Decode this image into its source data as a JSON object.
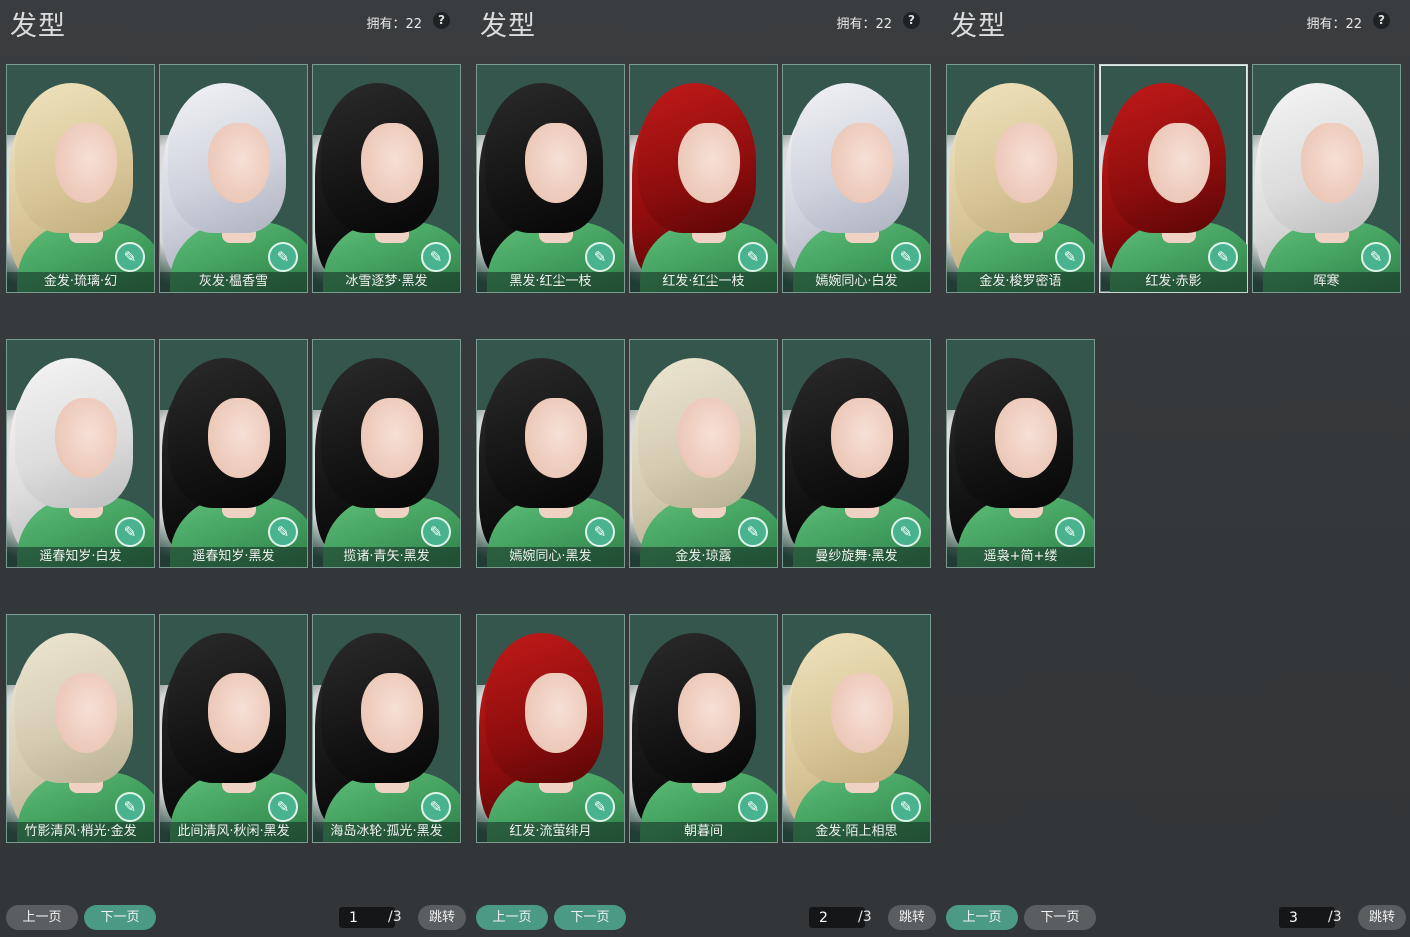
{
  "panels": [
    {
      "title": "发型",
      "owned": "拥有：22",
      "help": "?",
      "items": [
        {
          "label": "金发·琉璃·幻",
          "hair": "gold"
        },
        {
          "label": "灰发·榅香雪",
          "hair": "silver"
        },
        {
          "label": "冰雪逐梦·黑发",
          "hair": "black"
        },
        {
          "label": "遥春知岁·白发",
          "hair": "white"
        },
        {
          "label": "遥春知岁·黑发",
          "hair": "black"
        },
        {
          "label": "揽诸·青矢·黑发",
          "hair": "black"
        },
        {
          "label": "竹影清风·梢光·金发",
          "hair": "platinum"
        },
        {
          "label": "此间清风·秋闲·黑发",
          "hair": "black"
        },
        {
          "label": "海岛冰轮·孤光·黑发",
          "hair": "black"
        }
      ],
      "pager": {
        "prev": "上一页",
        "next": "下一页",
        "active": "next",
        "page": "1",
        "total": "/3",
        "jump": "跳转"
      }
    },
    {
      "title": "发型",
      "owned": "拥有：22",
      "help": "?",
      "items": [
        {
          "label": "黑发·红尘一枝",
          "hair": "black"
        },
        {
          "label": "红发·红尘一枝",
          "hair": "red"
        },
        {
          "label": "嫣婉同心·白发",
          "hair": "silver"
        },
        {
          "label": "嫣婉同心·黑发",
          "hair": "black"
        },
        {
          "label": "金发·琼露",
          "hair": "platinum"
        },
        {
          "label": "曼纱旋舞·黑发",
          "hair": "black"
        },
        {
          "label": "红发·流萤绯月",
          "hair": "red"
        },
        {
          "label": "朝暮间",
          "hair": "black"
        },
        {
          "label": "金发·陌上相思",
          "hair": "gold"
        }
      ],
      "pager": {
        "prev": "上一页",
        "next": "下一页",
        "active": "both",
        "page": "2",
        "total": "/3",
        "jump": "跳转"
      }
    },
    {
      "title": "发型",
      "owned": "拥有：22",
      "help": "?",
      "items": [
        {
          "label": "金发·梭罗密语",
          "hair": "gold"
        },
        {
          "label": "红发·赤影",
          "hair": "red",
          "selected": true
        },
        {
          "label": "晖寒",
          "hair": "white"
        },
        {
          "label": "遥袅+简+缕",
          "hair": "black"
        }
      ],
      "pager": {
        "prev": "上一页",
        "next": "下一页",
        "active": "prev",
        "page": "3",
        "total": "/3",
        "jump": "跳转"
      }
    }
  ],
  "badge_icon": "brush-icon",
  "colors": {
    "card_bg": "#34564c",
    "accent": "#4a9a85",
    "card_border": "#7a9c90"
  }
}
